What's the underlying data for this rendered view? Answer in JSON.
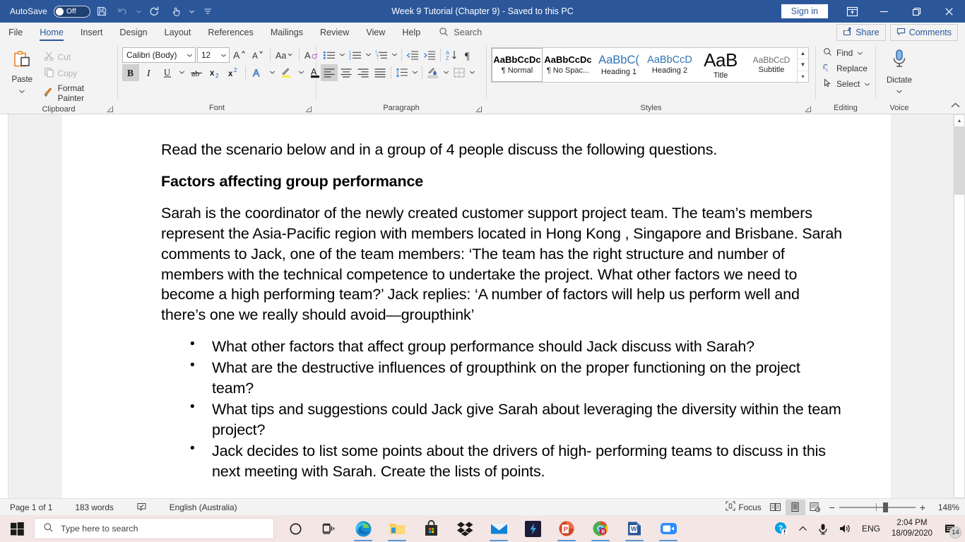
{
  "titlebar": {
    "autosave_label": "AutoSave",
    "autosave_state": "Off",
    "document_title": "Week 9 Tutorial (Chapter 9)  -  Saved to this PC",
    "signin_label": "Sign in",
    "qat": [
      {
        "name": "save-icon",
        "tooltip": "Save"
      },
      {
        "name": "undo-icon",
        "tooltip": "Undo"
      },
      {
        "name": "redo-icon",
        "tooltip": "Redo"
      },
      {
        "name": "touch-mode-icon",
        "tooltip": "Touch/Mouse Mode"
      },
      {
        "name": "customize-qat-icon",
        "tooltip": "Customize Quick Access Toolbar"
      }
    ],
    "window_controls": {
      "ribbon_display": "ribbon-display-options-icon",
      "minimize": "minimize-icon",
      "restore": "restore-icon",
      "close": "close-icon"
    },
    "accent_color": "#2b579a"
  },
  "tabs": [
    {
      "label": "File",
      "active": false
    },
    {
      "label": "Home",
      "active": true
    },
    {
      "label": "Insert",
      "active": false
    },
    {
      "label": "Design",
      "active": false
    },
    {
      "label": "Layout",
      "active": false
    },
    {
      "label": "References",
      "active": false
    },
    {
      "label": "Mailings",
      "active": false
    },
    {
      "label": "Review",
      "active": false
    },
    {
      "label": "View",
      "active": false
    },
    {
      "label": "Help",
      "active": false
    }
  ],
  "search": {
    "placeholder": "Search",
    "value": ""
  },
  "tabbar_right": {
    "share_label": "Share",
    "comments_label": "Comments"
  },
  "ribbon": {
    "groups": [
      {
        "label": "Clipboard"
      },
      {
        "label": "Font"
      },
      {
        "label": "Paragraph"
      },
      {
        "label": "Styles"
      },
      {
        "label": "Editing"
      },
      {
        "label": "Voice"
      }
    ],
    "clipboard": {
      "paste_label": "Paste",
      "cut_label": "Cut",
      "copy_label": "Copy",
      "format_painter_label": "Format Painter"
    },
    "font": {
      "font_name": "Calibri (Body)",
      "font_size": "12",
      "bold_active": true
    },
    "styles": [
      {
        "preview": "AaBbCcDc",
        "name": "¶ Normal",
        "selected": true,
        "color": "#000000",
        "bold": true,
        "size": 13
      },
      {
        "preview": "AaBbCcDc",
        "name": "¶ No Spac...",
        "selected": false,
        "color": "#000000",
        "bold": true,
        "size": 13
      },
      {
        "preview": "AaBbC(",
        "name": "Heading 1",
        "selected": false,
        "color": "#2e74b5",
        "bold": false,
        "size": 16
      },
      {
        "preview": "AaBbCcD",
        "name": "Heading 2",
        "selected": false,
        "color": "#2e74b5",
        "bold": false,
        "size": 14
      },
      {
        "preview": "AaB",
        "name": "Title",
        "selected": false,
        "color": "#000000",
        "bold": false,
        "size": 25
      },
      {
        "preview": "AaBbCcD",
        "name": "Subtitle",
        "selected": false,
        "color": "#595959",
        "bold": false,
        "size": 12
      }
    ],
    "editing": {
      "find_label": "Find",
      "replace_label": "Replace",
      "select_label": "Select"
    },
    "voice": {
      "dictate_label": "Dictate"
    }
  },
  "document": {
    "intro": "Read the scenario below and in a group of 4 people discuss the following questions.",
    "heading": "Factors affecting group performance",
    "scenario": "Sarah is the coordinator of the  newly created customer support project team. The team’s members represent the  Asia-Pacific region with members located in Hong Kong , Singapore  and Brisbane. Sarah comments  to  Jack, one of the  team members: ‘The team has the  right  structure and number of members with the technical  competence to undertake  the project. What  other factors we need  to become a high  performing team?’ Jack replies: ‘A number  of factors will help us perform well and  there’s one we  really  should avoid—groupthink’",
    "bullets": [
      "What   other factors that  affect group performance  should Jack discuss with Sarah?",
      "What  are  the destructive  influences of groupthink on the  proper functioning on the project  team?",
      "What  tips  and suggestions could Jack give Sarah about  leveraging  the diversity  within the team project?",
      "Jack decides to list  some points about  the drivers  of high- performing teams to discuss in this next  meeting  with Sarah. Create the lists  of points."
    ]
  },
  "statusbar": {
    "page": "Page 1 of 1",
    "words": "183 words",
    "proofing_icon": "proofing-errors-icon",
    "language": "English (Australia)",
    "focus_label": "Focus",
    "views": [
      {
        "name": "read-mode-view",
        "active": false
      },
      {
        "name": "print-layout-view",
        "active": true
      },
      {
        "name": "web-layout-view",
        "active": false
      }
    ],
    "zoom_out": "−",
    "zoom_in": "+",
    "zoom_level": "148%"
  },
  "taskbar": {
    "search_placeholder": "Type here to search",
    "icons": [
      {
        "name": "cortana-icon",
        "open": false
      },
      {
        "name": "task-view-icon",
        "open": false
      },
      {
        "name": "microsoft-edge-icon",
        "open": true
      },
      {
        "name": "file-explorer-icon",
        "open": true
      },
      {
        "name": "microsoft-store-icon",
        "open": false
      },
      {
        "name": "dropbox-icon",
        "open": false
      },
      {
        "name": "mail-icon",
        "open": true
      },
      {
        "name": "lightning-app-icon",
        "open": false
      },
      {
        "name": "powerpoint-icon",
        "open": true
      },
      {
        "name": "chrome-icon",
        "open": true
      },
      {
        "name": "word-icon",
        "open": true
      },
      {
        "name": "zoom-icon",
        "open": true
      }
    ],
    "tray": {
      "action_needed_icon": "account-warning-icon",
      "show_hidden_icon": "show-hidden-icons-icon",
      "mic_icon": "microphone-icon",
      "volume_icon": "volume-icon",
      "language": "ENG",
      "time": "2:04 PM",
      "date": "18/09/2020",
      "notification_count": "14"
    }
  }
}
